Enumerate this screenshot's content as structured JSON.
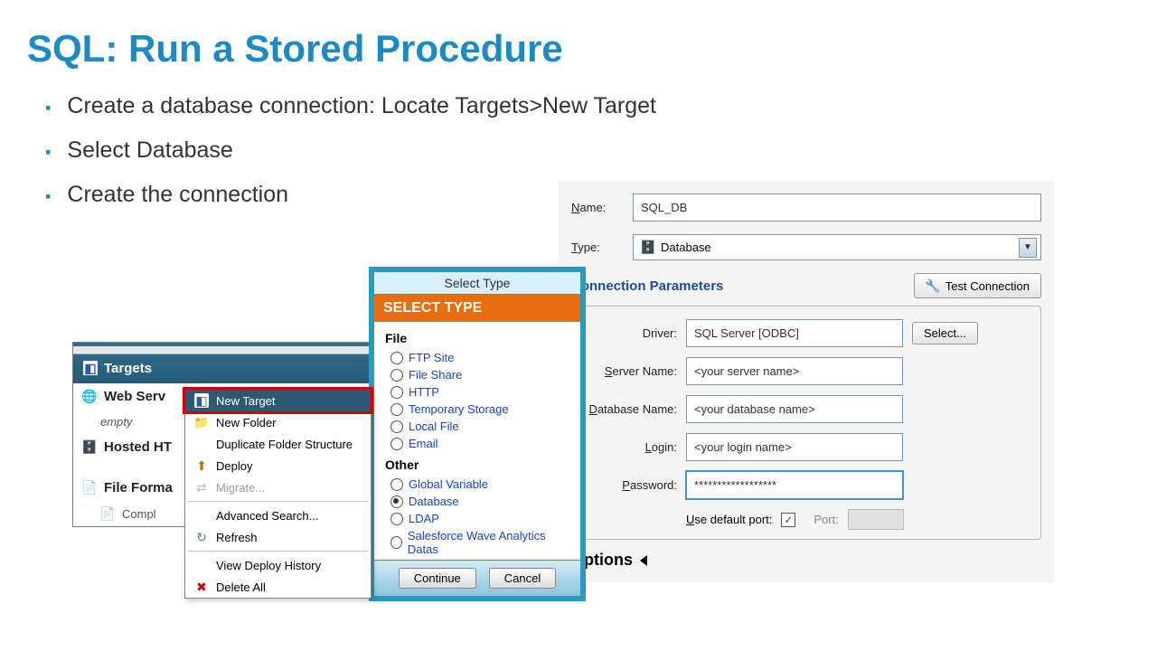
{
  "slide": {
    "title": "SQL: Run a Stored Procedure",
    "bullets": [
      "Create a database connection: Locate Targets>New Target",
      "Select Database",
      "Create the connection"
    ]
  },
  "targets_panel": {
    "header": "Targets",
    "rows": [
      {
        "icon": "globe-icon",
        "label": "Web Serv",
        "sublabel": "empty"
      },
      {
        "icon": "server-icon",
        "label": "Hosted HT"
      },
      {
        "icon": "file-icon",
        "label": "File Forma",
        "sublabel": "Compl"
      }
    ]
  },
  "context_menu": {
    "items": [
      {
        "name": "new-target",
        "icon": "target-icon",
        "label": "New Target",
        "highlight": true
      },
      {
        "name": "new-folder",
        "icon": "folder-icon",
        "label": "New Folder"
      },
      {
        "name": "duplicate-folder-structure",
        "label": "Duplicate Folder Structure"
      },
      {
        "name": "deploy",
        "icon": "deploy-icon",
        "label": "Deploy"
      },
      {
        "name": "migrate",
        "icon": "migrate-icon",
        "label": "Migrate...",
        "disabled": true
      },
      {
        "sep": true
      },
      {
        "name": "advanced-search",
        "label": "Advanced Search..."
      },
      {
        "name": "refresh",
        "icon": "refresh-icon",
        "label": "Refresh"
      },
      {
        "sep": true
      },
      {
        "name": "view-deploy-history",
        "label": "View Deploy History"
      },
      {
        "name": "delete-all",
        "icon": "delete-icon",
        "label": "Delete All"
      }
    ]
  },
  "select_type": {
    "topbar": "Select Type",
    "orangebar": "SELECT TYPE",
    "group_file": "File",
    "group_other": "Other",
    "options_file": [
      {
        "name": "ftp-site",
        "label": "FTP Site"
      },
      {
        "name": "file-share",
        "label": "File Share"
      },
      {
        "name": "http",
        "label": "HTTP"
      },
      {
        "name": "temporary-storage",
        "label": "Temporary Storage"
      },
      {
        "name": "local-file",
        "label": "Local File"
      },
      {
        "name": "email",
        "label": "Email"
      }
    ],
    "options_other": [
      {
        "name": "global-variable",
        "label": "Global Variable"
      },
      {
        "name": "database",
        "label": "Database",
        "selected": true
      },
      {
        "name": "ldap",
        "label": "LDAP"
      },
      {
        "name": "salesforce",
        "label": "Salesforce Wave Analytics Datas"
      }
    ],
    "continue": "Continue",
    "cancel": "Cancel"
  },
  "form": {
    "name_label": "Name:",
    "name_value": "SQL_DB",
    "type_label": "Type:",
    "type_value": "Database",
    "conn_title": "Connection Parameters",
    "test_conn": "Test Connection",
    "driver_label": "Driver:",
    "driver_value": "SQL Server [ODBC]",
    "select_btn": "Select...",
    "server_label": "Server Name:",
    "server_value": "<your server name>",
    "db_label": "Database Name:",
    "db_value": "<your database name>",
    "login_label": "Login:",
    "login_value": "<your login name>",
    "pw_label": "Password:",
    "pw_value": "******************",
    "use_default_port": "Use default port:",
    "port_label": "Port:",
    "options_label": "Options"
  }
}
